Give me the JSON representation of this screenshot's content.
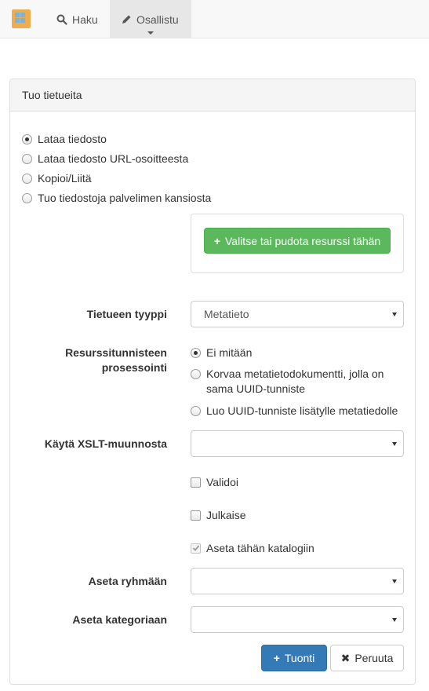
{
  "nav": {
    "search_label": "Haku",
    "contribute_label": "Osallistu"
  },
  "panel": {
    "title": "Tuo tietueita",
    "import_modes": [
      {
        "label": "Lataa tiedosto",
        "checked": true
      },
      {
        "label": "Lataa tiedosto URL-osoitteesta",
        "checked": false
      },
      {
        "label": "Kopioi/Liitä",
        "checked": false
      },
      {
        "label": "Tuo tiedostoja palvelimen kansiosta",
        "checked": false
      }
    ],
    "upload_button": "Valitse tai pudota resurssi tähän",
    "record_type": {
      "label": "Tietueen tyyppi",
      "value": "Metatieto"
    },
    "uuid_processing": {
      "label_line1": "Resurssitunnisteen",
      "label_line2": "prosessointi",
      "options": [
        {
          "label": "Ei mitään",
          "checked": true
        },
        {
          "label_line1": "Korvaa metatietodokumentti, jolla on",
          "label_line2": "sama UUID-tunniste",
          "checked": false
        },
        {
          "label": "Luo UUID-tunniste lisätylle metatiedolle",
          "checked": false
        }
      ]
    },
    "xslt": {
      "label": "Käytä XSLT-muunnosta",
      "value": ""
    },
    "validate": {
      "label": "Validoi",
      "checked": false
    },
    "publish": {
      "label": "Julkaise",
      "checked": false
    },
    "assign_catalog": {
      "label": "Aseta tähän katalogiin",
      "checked": true
    },
    "group": {
      "label": "Aseta ryhmään",
      "value": ""
    },
    "category": {
      "label": "Aseta kategoriaan",
      "value": ""
    },
    "import_button": "Tuonti",
    "cancel_button": "Peruuta"
  },
  "colors": {
    "success": "#5cb85c",
    "primary": "#337ab7",
    "logo": "#f0ad4e"
  }
}
